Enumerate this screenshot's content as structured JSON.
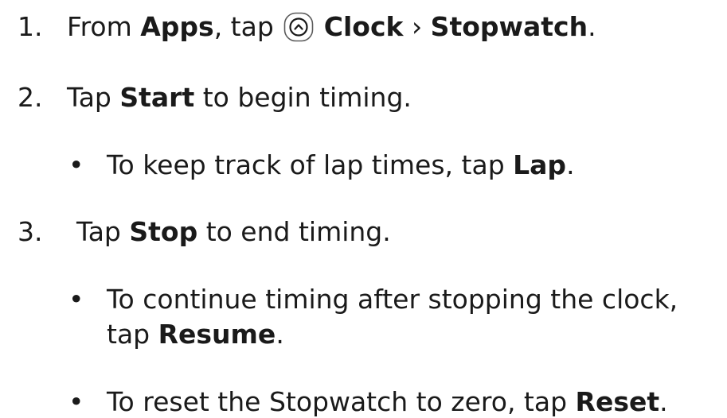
{
  "steps": [
    {
      "number": "1.",
      "parts": {
        "t1": "From ",
        "b1": "Apps",
        "t2": ", tap ",
        "icon": "clock-app-icon",
        "b2": "Clock",
        "t3": " › ",
        "b3": "Stopwatch",
        "t4": "."
      }
    },
    {
      "number": "2.",
      "parts": {
        "t1": "Tap ",
        "b1": "Start",
        "t2": " to begin timing."
      }
    },
    {
      "number": "3.",
      "parts": {
        "t1": "Tap ",
        "b1": "Stop",
        "t2": " to end timing."
      }
    }
  ],
  "bullets": [
    {
      "symbol": "•",
      "parts": {
        "t1": "To keep track of lap times, tap ",
        "b1": "Lap",
        "t2": "."
      }
    },
    {
      "symbol": "•",
      "parts": {
        "t1": "To continue timing after stopping the clock,",
        "t2": "tap ",
        "b1": "Resume",
        "t3": "."
      }
    },
    {
      "symbol": "•",
      "parts": {
        "t1": "To reset the Stopwatch to zero, tap ",
        "b1": "Reset",
        "t2": "."
      }
    }
  ]
}
